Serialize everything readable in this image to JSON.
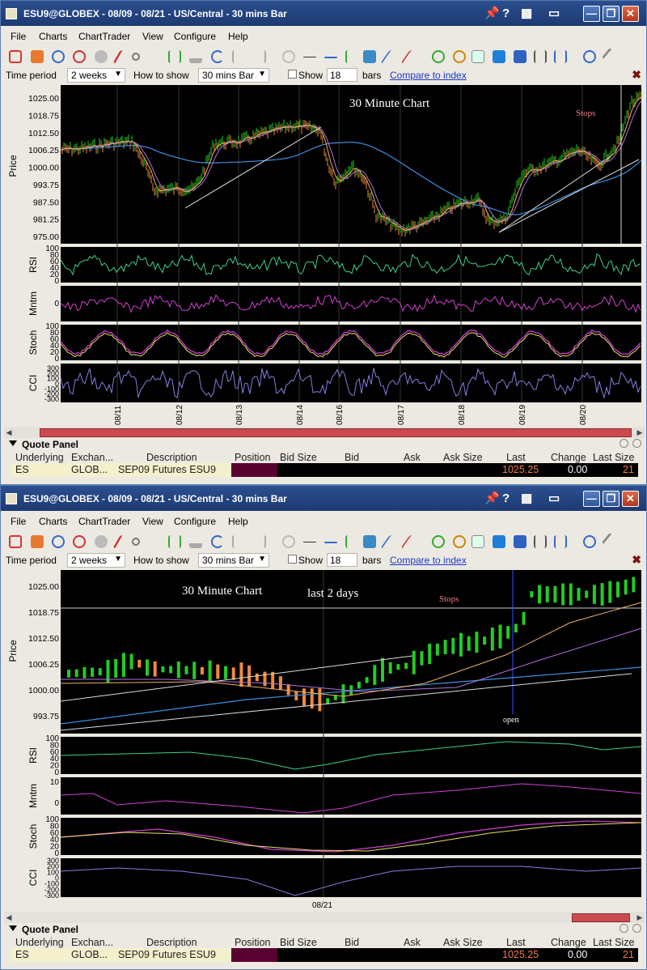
{
  "windows": [
    {
      "title": "ESU9@GLOBEX - 08/09 - 08/21 - US/Central - 30 mins Bar",
      "menu": [
        "File",
        "Charts",
        "ChartTrader",
        "View",
        "Configure",
        "Help"
      ],
      "options": {
        "time_period_label": "Time period",
        "time_period": "2 weeks",
        "how_to_show_label": "How to show",
        "how_to_show": "30 mins Bar",
        "show_label": "Show",
        "show_value": "18",
        "bars_label": "bars",
        "compare_link": "Compare to index"
      },
      "chart": {
        "annotation": "30 Minute Chart",
        "stops_label": "Stops",
        "price_axis_label": "Price",
        "price_ticks": [
          "1025.00",
          "1018.75",
          "1012.50",
          "1006.25",
          "1000.00",
          "993.75",
          "987.50",
          "981.25",
          "975.00"
        ],
        "rsi_label": "RSI",
        "rsi_ticks": [
          "100",
          "80",
          "60",
          "40",
          "20",
          "0"
        ],
        "mntm_label": "Mntm",
        "mntm_ticks": [
          "0"
        ],
        "stoch_label": "Stoch",
        "stoch_ticks": [
          "100",
          "80",
          "60",
          "40",
          "20",
          "0"
        ],
        "cci_label": "CCI",
        "cci_ticks": [
          "300",
          "200",
          "100",
          "0",
          "-100",
          "-200",
          "-300"
        ],
        "dates": [
          "08/11",
          "08/12",
          "08/13",
          "08/14",
          "08/16",
          "08/17",
          "08/18",
          "08/19",
          "08/20"
        ]
      },
      "quote_panel": {
        "title": "Quote Panel",
        "headers": [
          "Underlying",
          "Exchan...",
          "Description",
          "Position",
          "Bid Size",
          "Bid",
          "Ask",
          "Ask Size",
          "Last",
          "Change",
          "Last Size"
        ],
        "row": {
          "underlying": "ES",
          "exchange": "GLOB...",
          "description": "SEP09 Futures ESU9",
          "last": "1025.25",
          "change": "0.00",
          "last_size": "21"
        }
      }
    },
    {
      "title": "ESU9@GLOBEX - 08/09 - 08/21 - US/Central - 30 mins Bar",
      "menu": [
        "File",
        "Charts",
        "ChartTrader",
        "View",
        "Configure",
        "Help"
      ],
      "options": {
        "time_period_label": "Time period",
        "time_period": "2 weeks",
        "how_to_show_label": "How to show",
        "how_to_show": "30 mins Bar",
        "show_label": "Show",
        "show_value": "18",
        "bars_label": "bars",
        "compare_link": "Compare to index"
      },
      "chart": {
        "annotation": "30 Minute Chart",
        "annotation2": "last 2 days",
        "stops_label": "Stops",
        "open_label": "open",
        "price_axis_label": "Price",
        "price_ticks": [
          "1025.00",
          "1018.75",
          "1012.50",
          "1006.25",
          "1000.00",
          "993.75"
        ],
        "rsi_label": "RSI",
        "rsi_ticks": [
          "100",
          "80",
          "60",
          "40",
          "20",
          "0"
        ],
        "mntm_label": "Mntm",
        "mntm_ticks": [
          "10",
          "0"
        ],
        "stoch_label": "Stoch",
        "stoch_ticks": [
          "100",
          "80",
          "60",
          "40",
          "20",
          "0"
        ],
        "cci_label": "CCI",
        "cci_ticks": [
          "300",
          "200",
          "100",
          "0",
          "-100",
          "-200",
          "-300"
        ],
        "dates": [
          "08/21"
        ]
      },
      "quote_panel": {
        "title": "Quote Panel",
        "headers": [
          "Underlying",
          "Exchan...",
          "Description",
          "Position",
          "Bid Size",
          "Bid",
          "Ask",
          "Ask Size",
          "Last",
          "Change",
          "Last Size"
        ],
        "row": {
          "underlying": "ES",
          "exchange": "GLOB...",
          "description": "SEP09 Futures ESU9",
          "last": "1025.25",
          "change": "0.00",
          "last_size": "21"
        }
      }
    }
  ],
  "colors": {
    "chart_bg": "#000000",
    "up_bar": "#22cc22",
    "down_bar": "#f08a3c",
    "ma_blue": "#3d8fe0",
    "ma_orange": "#f0b060",
    "ma_violet": "#b070e0",
    "rsi": "#3ecf86",
    "mntm": "#d040d0",
    "stoch_k": "#d040d0",
    "stoch_d": "#e8e060",
    "cci": "#8080e0",
    "title_bar": "#1d3a72"
  }
}
